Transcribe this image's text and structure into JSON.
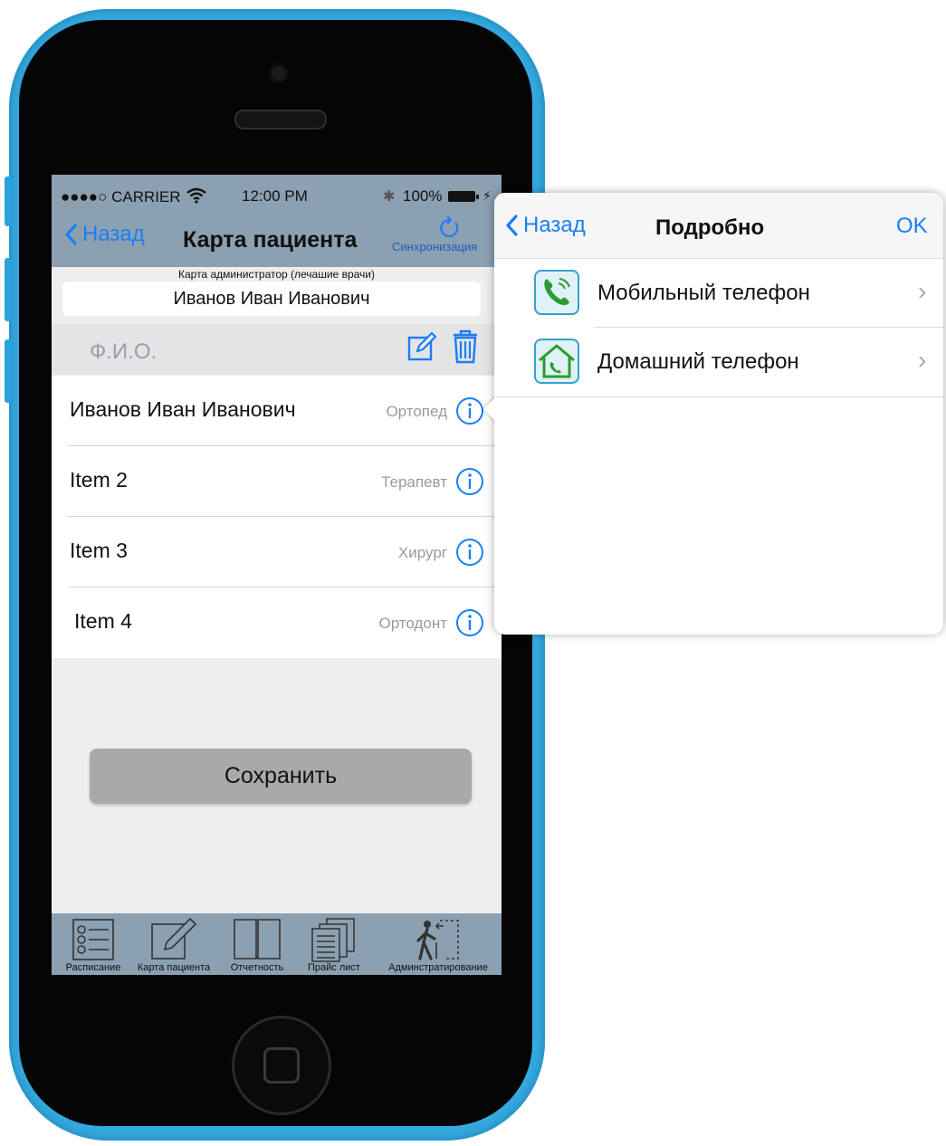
{
  "status_bar": {
    "signal": "●●●●○",
    "carrier": "CARRIER",
    "time": "12:00 PM",
    "battery": "100%"
  },
  "nav": {
    "back_label": "Назад",
    "title": "Карта пациента",
    "sync_label": "Синхронизация"
  },
  "card": {
    "subtitle": "Карта администратор (лечашие врачи)",
    "patient_name": "Иванов Иван Иванович",
    "fio_label": "Ф.И.О."
  },
  "doctors": [
    {
      "name": "Иванов Иван Иванович",
      "specialty": "Ортопед"
    },
    {
      "name": "Item 2",
      "specialty": "Терапевт"
    },
    {
      "name": "Item 3",
      "specialty": "Хирург"
    },
    {
      "name": "Item 4",
      "specialty": "Ортодонт"
    }
  ],
  "save_label": "Сохранить",
  "tabs": [
    {
      "label": "Расписание",
      "icon": "schedule-list-icon"
    },
    {
      "label": "Карта пациента",
      "icon": "edit-card-icon"
    },
    {
      "label": "Отчетность",
      "icon": "book-icon"
    },
    {
      "label": "Прайс лист",
      "icon": "price-list-icon"
    },
    {
      "label": "Админстратирование",
      "icon": "admin-exit-icon"
    }
  ],
  "popover": {
    "back_label": "Назад",
    "title": "Подробно",
    "ok_label": "OK",
    "items": [
      {
        "label": "Мобильный телефон",
        "icon": "mobile-phone-icon"
      },
      {
        "label": "Домашний телефон",
        "icon": "home-phone-icon"
      }
    ]
  },
  "colors": {
    "phone_body": "#35aee6",
    "nav_bar": "#8ba0b0",
    "accent": "#1a7ef5",
    "icon_green": "#2f9a2f"
  }
}
